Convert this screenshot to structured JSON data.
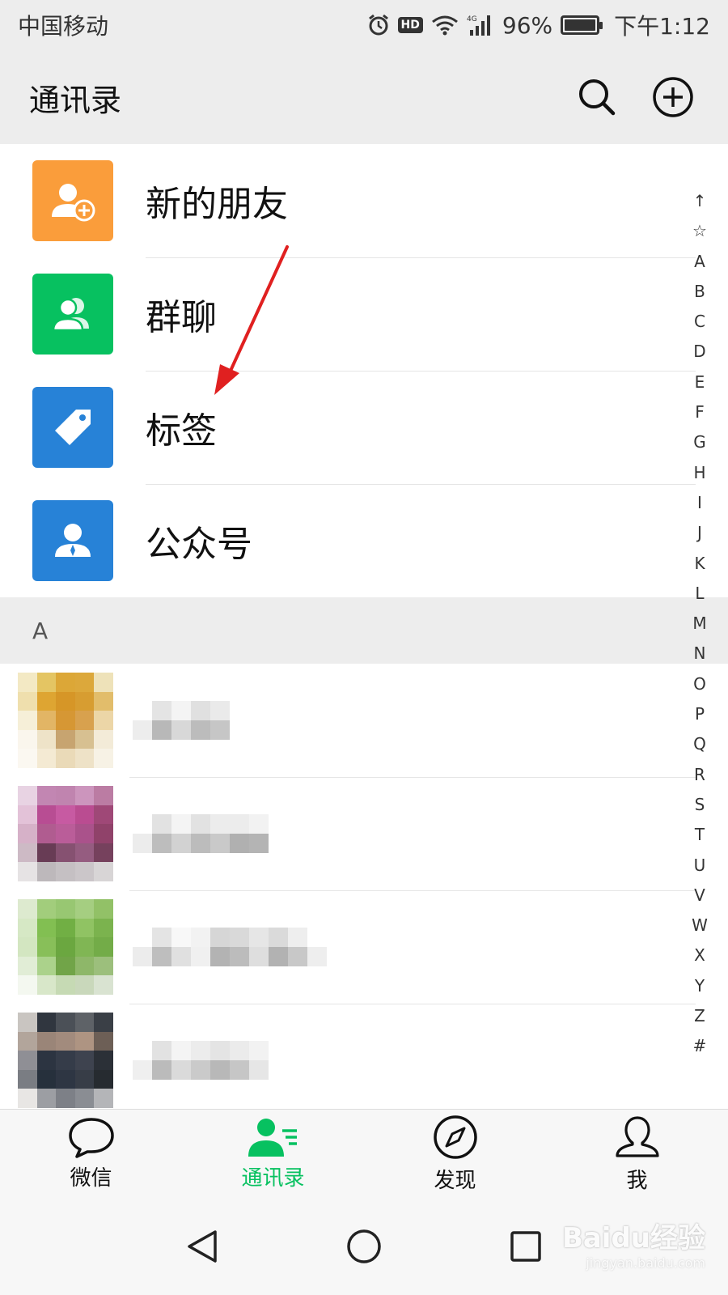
{
  "status_bar": {
    "carrier": "中国移动",
    "network": "4G",
    "battery": "96%",
    "time": "下午1:12",
    "hd": "HD"
  },
  "header": {
    "title": "通讯录",
    "search_icon": "search-icon",
    "add_icon": "add-icon"
  },
  "functions": [
    {
      "label": "新的朋友",
      "icon": "new-friend-icon",
      "color": "#fa9d3b"
    },
    {
      "label": "群聊",
      "icon": "group-chat-icon",
      "color": "#07c160"
    },
    {
      "label": "标签",
      "icon": "tag-icon",
      "color": "#2782d7"
    },
    {
      "label": "公众号",
      "icon": "official-account-icon",
      "color": "#2782d7"
    }
  ],
  "section": {
    "letter": "A"
  },
  "alphabet": [
    "↑",
    "☆",
    "A",
    "B",
    "C",
    "D",
    "E",
    "F",
    "G",
    "H",
    "I",
    "J",
    "K",
    "L",
    "M",
    "N",
    "O",
    "P",
    "Q",
    "R",
    "S",
    "T",
    "U",
    "V",
    "W",
    "X",
    "Y",
    "Z",
    "#"
  ],
  "tabs": [
    {
      "label": "微信",
      "icon": "chat-bubble-icon",
      "active": false
    },
    {
      "label": "通讯录",
      "icon": "contacts-icon",
      "active": true
    },
    {
      "label": "发现",
      "icon": "compass-icon",
      "active": false
    },
    {
      "label": "我",
      "icon": "person-icon",
      "active": false
    }
  ],
  "colors": {
    "accent": "#07c160",
    "background": "#ededed",
    "annotation_arrow": "#e02020"
  },
  "watermark": {
    "main": "Baidu经验",
    "sub": "jingyan.baidu.com"
  }
}
